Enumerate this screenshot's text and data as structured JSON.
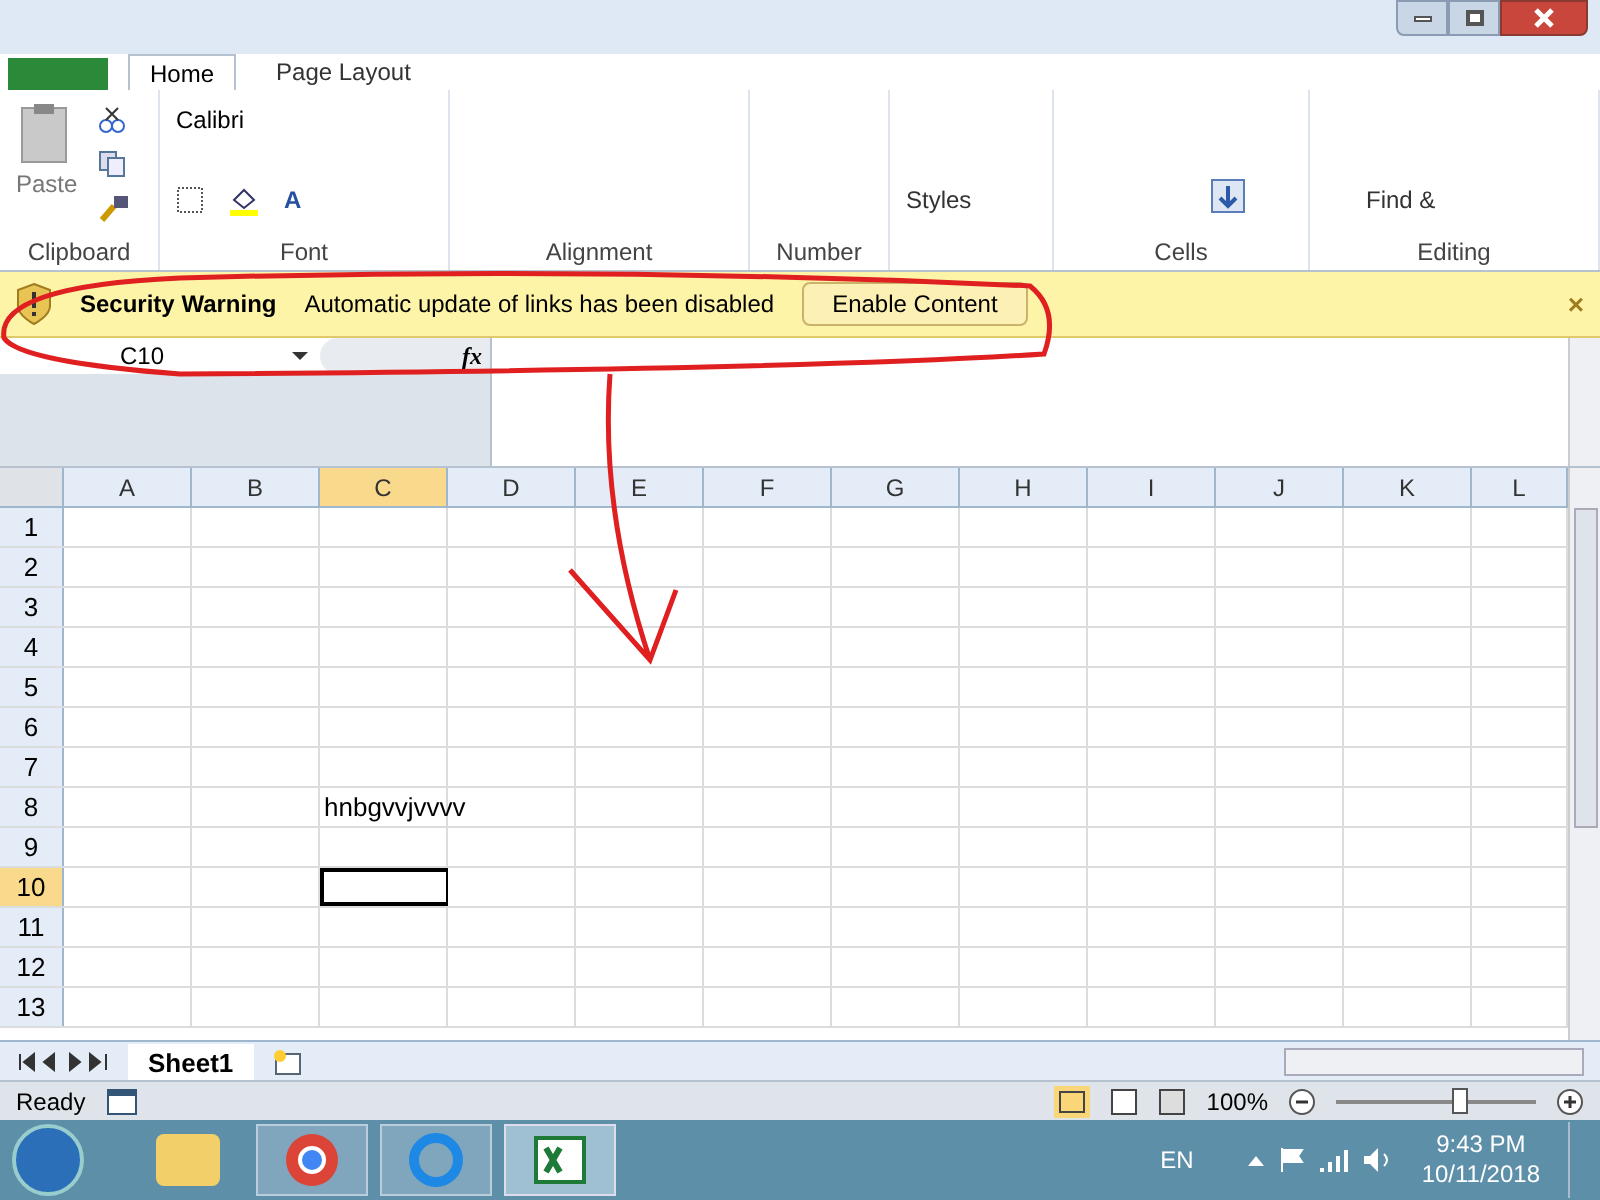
{
  "ribbon": {
    "tabs": [
      {
        "label": "Home",
        "selected": true
      },
      {
        "label": "Page Layout",
        "selected": false
      }
    ],
    "paste_label": "Paste",
    "font_name": "Calibri",
    "font_color_label": "A",
    "styles_label": "Styles",
    "find_label": "Find &",
    "groups": [
      "Clipboard",
      "Font",
      "Alignment",
      "Number",
      "Cells",
      "Editing"
    ]
  },
  "security_bar": {
    "title": "Security Warning",
    "message": "Automatic update of links has been disabled",
    "button": "Enable Content",
    "close": "×"
  },
  "formula_bar": {
    "name_box": "C10",
    "fx": "fx"
  },
  "sheet": {
    "columns": [
      {
        "label": "A",
        "selected": false
      },
      {
        "label": "B",
        "selected": false
      },
      {
        "label": "C",
        "selected": true
      },
      {
        "label": "D",
        "selected": false
      },
      {
        "label": "E",
        "selected": false
      },
      {
        "label": "F",
        "selected": false
      },
      {
        "label": "G",
        "selected": false
      },
      {
        "label": "H",
        "selected": false
      },
      {
        "label": "I",
        "selected": false
      },
      {
        "label": "J",
        "selected": false
      },
      {
        "label": "K",
        "selected": false
      },
      {
        "label": "L",
        "selected": false
      }
    ],
    "rows": [
      {
        "label": "1",
        "selected": false,
        "cells": {}
      },
      {
        "label": "2",
        "selected": false,
        "cells": {}
      },
      {
        "label": "3",
        "selected": false,
        "cells": {}
      },
      {
        "label": "4",
        "selected": false,
        "cells": {}
      },
      {
        "label": "5",
        "selected": false,
        "cells": {}
      },
      {
        "label": "6",
        "selected": false,
        "cells": {}
      },
      {
        "label": "7",
        "selected": false,
        "cells": {}
      },
      {
        "label": "8",
        "selected": false,
        "cells": {
          "2": "hnbgvvjvvvv"
        }
      },
      {
        "label": "9",
        "selected": false,
        "cells": {}
      },
      {
        "label": "10",
        "selected": true,
        "cells": {}
      },
      {
        "label": "11",
        "selected": false,
        "cells": {}
      },
      {
        "label": "12",
        "selected": false,
        "cells": {}
      },
      {
        "label": "13",
        "selected": false,
        "cells": {}
      }
    ]
  },
  "sheet_tabs": [
    {
      "label": "Sheet1",
      "selected": true
    }
  ],
  "status_bar": {
    "status": "Ready",
    "zoom": "100%",
    "zoom_slider": {
      "level": 0.62
    }
  },
  "taskbar": {
    "language": "EN",
    "time": "9:43 PM",
    "date": "10/11/2018"
  }
}
